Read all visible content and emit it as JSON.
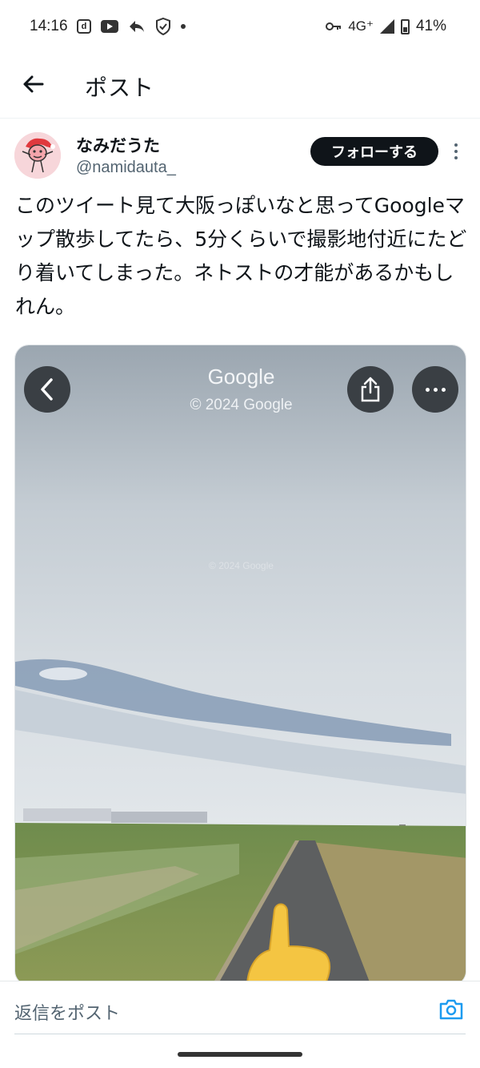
{
  "status_bar": {
    "time": "14:16",
    "notification_icons": [
      "docomo-d-icon",
      "youtube-icon",
      "reply-arrow-icon",
      "shield-check-icon",
      "dot-icon"
    ],
    "network": "4G⁺",
    "battery": "41%"
  },
  "header": {
    "title": "ポスト",
    "back_icon": "arrow-left-icon"
  },
  "post": {
    "author": {
      "display_name": "なみだうた",
      "handle": "@namidauta_"
    },
    "follow_label": "フォローする",
    "text": "このツイート見て大阪っぽいなと思ってGoogleマップ散歩してたら、5分くらいで撮影地付近にたどり着いてしまった。ネトストの才能があるかもしれん。",
    "media": {
      "brand": "Google",
      "copyright": "© 2024 Google",
      "watermark": "© 2024 Google",
      "icons": [
        "chevron-left-icon",
        "share-icon",
        "more-horizontal-icon"
      ]
    }
  },
  "reply_bar": {
    "placeholder": "返信をポスト",
    "icon": "camera-icon",
    "accent_color": "#1d9bf0"
  }
}
